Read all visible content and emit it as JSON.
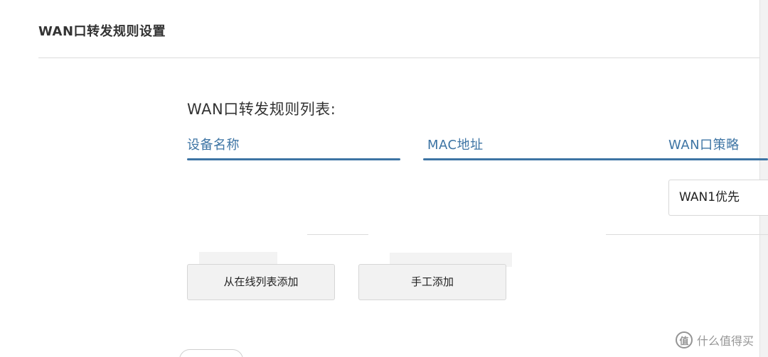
{
  "header": {
    "title": "WAN口转发规则设置"
  },
  "rules": {
    "section_label": "WAN口转发规则列表:",
    "columns": {
      "device": "设备名称",
      "mac": "MAC地址",
      "policy": "WAN口策略"
    },
    "rows": [
      {
        "policy": "WAN1优先"
      }
    ]
  },
  "actions": {
    "add_from_online": "从在线列表添加",
    "add_manual": "手工添加"
  },
  "watermark": {
    "badge": "值",
    "text": "什么值得买"
  },
  "colors": {
    "accent": "#3d74a4",
    "button_bg": "#f2f2f2",
    "border": "#d6d6d6"
  }
}
